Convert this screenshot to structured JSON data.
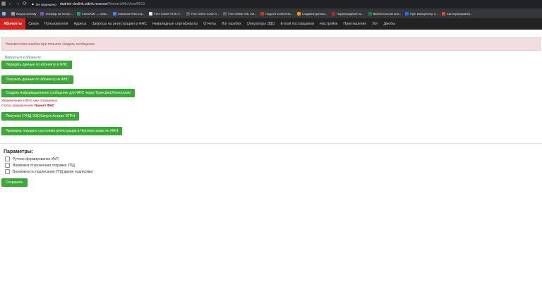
{
  "browser": {
    "back_icon": "←",
    "forward_icon": "→",
    "reload_icon": "⟳",
    "lock_icon": "▲",
    "security_label": "Не защищено",
    "url_host": "dadmin-doclink.cidink.moscow",
    "url_path": "/Abonent/MioView/8913"
  },
  "bookmarks": [
    {
      "label": "",
      "color": "#8ab4f8"
    },
    {
      "label": "Вход в систему",
      "color": "#9aa0a6"
    },
    {
      "label": "Очередь на тестир...",
      "color": "#7b4fd1"
    },
    {
      "label": "CheckXML — пров...",
      "color": "#1ea362"
    },
    {
      "label": "Описание Web-сер...",
      "color": "#4285f4"
    },
    {
      "label": "Free Online HTML F...",
      "color": "#e8eaed"
    },
    {
      "label": "Free Online GUID G...",
      "color": "#5f6368"
    },
    {
      "label": "Free Online XML Val...",
      "color": "#5f6368"
    },
    {
      "label": "Подсчет количеств...",
      "color": "#d93025"
    },
    {
      "label": "Создание данных...",
      "color": "#f29900"
    },
    {
      "label": "Подтверждение по...",
      "color": "#c5221f"
    },
    {
      "label": "Base64 Decode and...",
      "color": "#188038"
    },
    {
      "label": "НДС калькулятор о...",
      "color": "#1a73e8"
    },
    {
      "label": "Как перформагер...",
      "color": "#ea4335"
    }
  ],
  "app_nav": [
    {
      "label": "Абоненты",
      "active": true
    },
    {
      "label": "Связи"
    },
    {
      "label": "Пользователи"
    },
    {
      "label": "Адреса"
    },
    {
      "label": "Запросы на регистрацию в ФНС"
    },
    {
      "label": "Невалидные сертификаты"
    },
    {
      "label": "Отчеты"
    },
    {
      "label": "Лог ошибок"
    },
    {
      "label": "Операторы ЭДО"
    },
    {
      "label": "E-mail поставщиков"
    },
    {
      "label": "Настройки"
    },
    {
      "label": "Приглашения"
    },
    {
      "label": "Лог"
    },
    {
      "label": "Джобы"
    }
  ],
  "alert": {
    "text": "Неизвестная ошибка при попытке создать сообщение"
  },
  "back_link": "Вернуться к абоненту",
  "actions": {
    "send_to_fns": "Передать данные по абоненту в ФНС",
    "receive_from_fns": "Получить данные по абоненту из ФНС",
    "create_info_message": "Создать информационное сообщение для ФНС через ТрансферТехнологии",
    "get_guid": "Получить ГУИД ЭЭД Калуга Астрал ЭТРН",
    "check_registration": "Проверка текущего состояния регистрации в Честном знаке по ИНН"
  },
  "notice": {
    "line1": "Уведомление в ФНС уже отправлено",
    "status_label": "Статус уведомления:",
    "status_value": "Принят ФНС"
  },
  "params": {
    "title": "Параметры:",
    "options": [
      "Ручное формирование ИоП",
      "Возможна отсроченная отправка УПД",
      "Возможность подписания УПД двумя подписями"
    ]
  },
  "save_label": "Сохранить"
}
